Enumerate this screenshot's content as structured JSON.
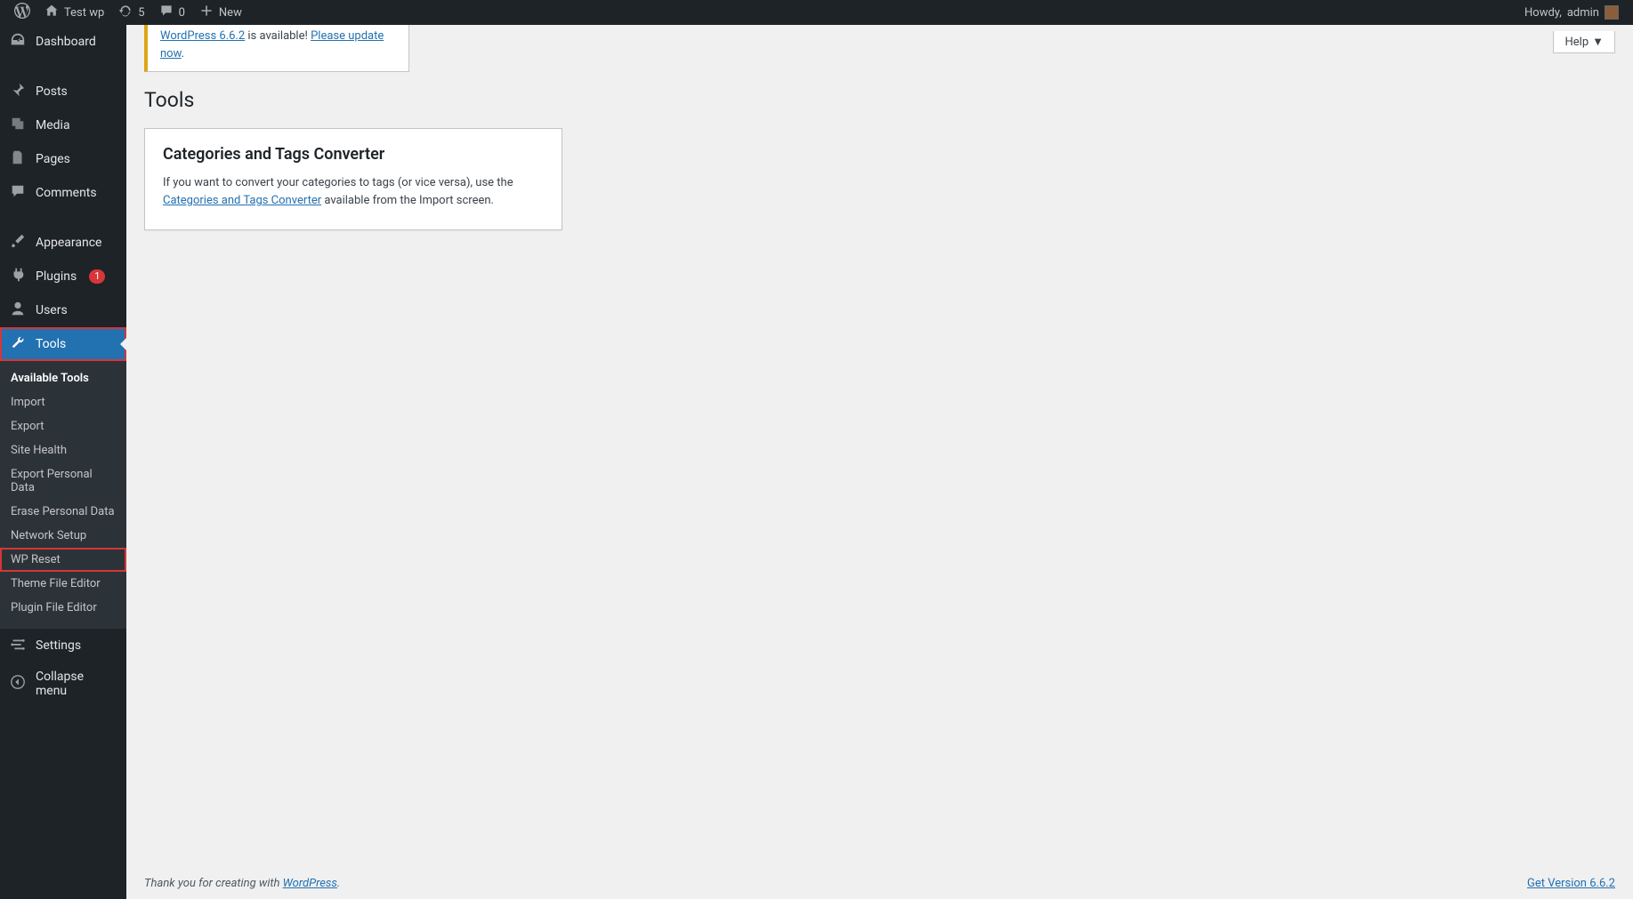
{
  "adminbar": {
    "site_name": "Test wp",
    "updates_count": "5",
    "comments_count": "0",
    "new_label": "New",
    "howdy_prefix": "Howdy, ",
    "user": "admin"
  },
  "menu": {
    "dashboard": "Dashboard",
    "posts": "Posts",
    "media": "Media",
    "pages": "Pages",
    "comments": "Comments",
    "appearance": "Appearance",
    "plugins": "Plugins",
    "plugins_badge": "1",
    "users": "Users",
    "tools": "Tools",
    "settings": "Settings",
    "collapse": "Collapse menu"
  },
  "submenu": {
    "available_tools": "Available Tools",
    "import": "Import",
    "export": "Export",
    "site_health": "Site Health",
    "export_personal": "Export Personal Data",
    "erase_personal": "Erase Personal Data",
    "network_setup": "Network Setup",
    "wp_reset": "WP Reset",
    "theme_editor": "Theme File Editor",
    "plugin_editor": "Plugin File Editor"
  },
  "help_label": "Help",
  "notice": {
    "wp_link": "WordPress 6.6.2",
    "available_text": " is available! ",
    "update_link": "Please update now",
    "period": "."
  },
  "page_title": "Tools",
  "card": {
    "heading": "Categories and Tags Converter",
    "text_before": "If you want to convert your categories to tags (or vice versa), use the ",
    "link": "Categories and Tags Converter",
    "text_after": " available from the Import screen."
  },
  "footer": {
    "thank_you_prefix": "Thank you for creating with ",
    "wp": "WordPress",
    "period": ".",
    "get_version": "Get Version 6.6.2"
  }
}
